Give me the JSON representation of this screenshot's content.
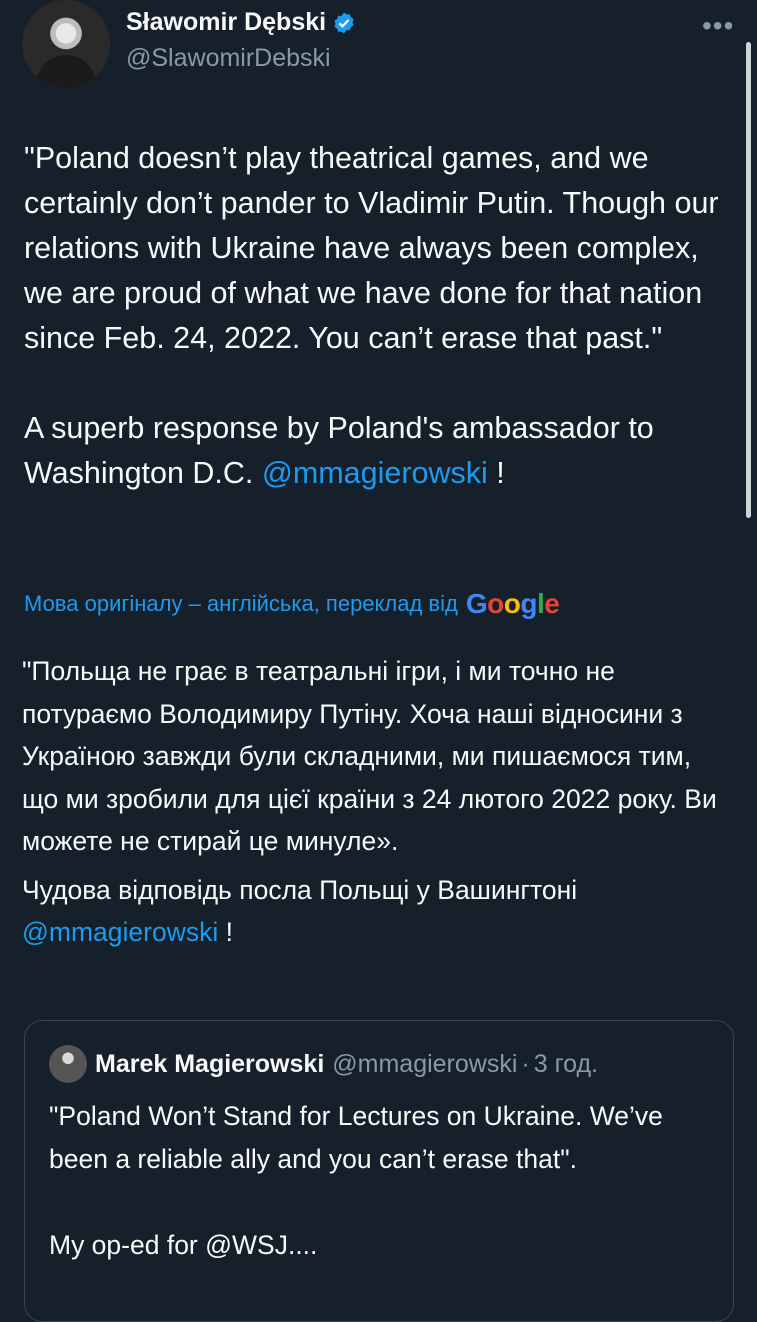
{
  "author": {
    "name": "Sławomir Dębski",
    "handle": "@SlawomirDebski",
    "verified_icon": "verified-badge-icon",
    "more_icon": "more-dots-icon"
  },
  "tweet": {
    "text_part1": "\"Poland doesn’t play theatrical games, and we certainly don’t pander to Vladimir Putin. Though our relations with Ukraine have always been complex, we are proud of what we have done for that nation since Feb. 24, 2022. You can’t erase that past.\"\n\nA superb response by Poland's ambassador to Washington D.C. ",
    "mention": "@mmagierowski",
    "text_end": " !"
  },
  "translation": {
    "label": "Мова оригіналу – англійська, переклад від",
    "provider": "Google",
    "paragraph1": "\"Польща не грає в театральні ігри, і ми точно не потураємо Володимиру Путіну. Хоча наші відносини з Україною завжди були складними, ми пишаємося тим, що ми зробили для цієї країни з 24 лютого 2022 року. Ви можете не стирай це минуле».",
    "paragraph2_text": "Чудова відповідь посла Польщі у Вашингтоні ",
    "paragraph2_mention": "@mmagierowski",
    "paragraph2_end": " !"
  },
  "quote": {
    "name": "Marek Magierowski",
    "handle": "@mmagierowski",
    "separator": "·",
    "time": "3 год.",
    "text": "\"Poland Won’t Stand for Lectures on Ukraine. We’ve been a reliable ally and you can’t erase that\".\n\nMy op-ed for @WSJ...."
  },
  "colors": {
    "background": "#15202b",
    "accent": "#1d9bf0",
    "secondary_text": "#8b98a5"
  }
}
